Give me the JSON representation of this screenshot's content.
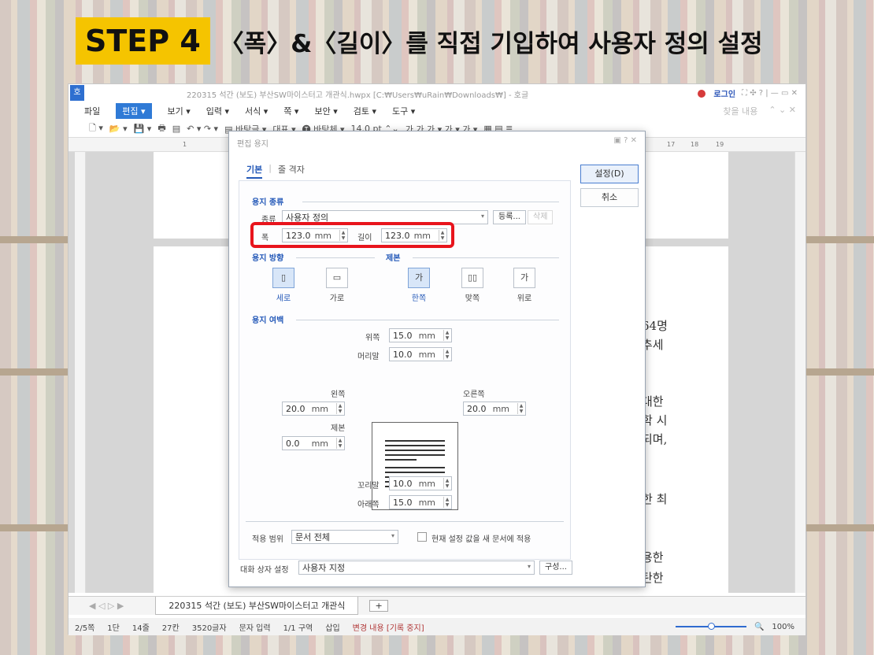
{
  "banner": {
    "step": "STEP 4",
    "title": "〈폭〉&〈길이〉를 직접 기입하여 사용자 정의 설정"
  },
  "window": {
    "title": "220315 석간 (보도) 부산SW마이스터고 개관식.hwpx [C:₩Users₩uRain₩Downloads₩] - 호글",
    "logo": "호",
    "login": "로그인",
    "controls": "⛶ ✣ ? | — ▭ ✕"
  },
  "menubar": {
    "items": [
      "파일",
      "편집 ▾",
      "보기 ▾",
      "입력 ▾",
      "서식 ▾",
      "쪽 ▾",
      "보안 ▾",
      "검토 ▾",
      "도구 ▾"
    ],
    "right": [
      "찾을 내용",
      "⌃ ⌄ ✕"
    ]
  },
  "toolbar": {
    "items": [
      "🗋 ▾",
      "📂 ▾",
      "💾 ▾",
      "🖶",
      "▤",
      "↶ ▾ ↷ ▾",
      "▤ 바탕글 ▾",
      "대표 ▾",
      "🅣 바탕체 ▾",
      "14.0 pt ⌃⌄",
      "가 가 가 ▾ 가 ▾ 가 ▾",
      "▦ ▤ ≣"
    ]
  },
  "ruler": {
    "marks": [
      "1",
      "17",
      "18",
      "19"
    ]
  },
  "document": {
    "lines": [
      "64명",
      "추세",
      "대한",
      "학 시",
      "되며,",
      "한 최",
      "용한",
      "탄한"
    ]
  },
  "tabbar": {
    "nav": "◀ ◁ ▷ ▶",
    "doc_tab": "220315 석간 (보도) 부산SW마이스터고 개관식",
    "plus": "+"
  },
  "statusbar": {
    "items": [
      "2/5쪽",
      "1단",
      "14줄",
      "27칸",
      "3520글자",
      "문자 입력",
      "1/1 구역",
      "삽입"
    ],
    "changes": "변경 내용 [기록 중지]",
    "zoom": "100%",
    "zoom_level": 0.5
  },
  "dialog": {
    "title": "편집 용지",
    "controls": "▣ ? ✕",
    "tabs": [
      "기본",
      "줄 격자"
    ],
    "ok": "설정(D)",
    "cancel": "취소",
    "paper_type": {
      "section": "용지 종류",
      "kind_label": "종류",
      "kind_value": "사용자 정의",
      "register": "등록...",
      "delete": "삭제",
      "width_label": "폭",
      "width_value": "123.0",
      "height_label": "길이",
      "height_value": "123.0",
      "unit": "mm"
    },
    "orientation": {
      "section": "용지 방향",
      "portrait": "세로",
      "landscape": "가로"
    },
    "binding": {
      "section": "제본",
      "single": "한쪽",
      "facing": "맞쪽",
      "top": "위로"
    },
    "margins": {
      "section": "용지 여백",
      "top_label": "위쪽",
      "top": "15.0",
      "header_label": "머리말",
      "header": "10.0",
      "left_label": "왼쪽",
      "left": "20.0",
      "right_label": "오른쪽",
      "right": "20.0",
      "gutter_label": "제본",
      "gutter": "0.0",
      "footer_label": "꼬리말",
      "footer": "10.0",
      "bottom_label": "아래쪽",
      "bottom": "15.0",
      "unit": "mm"
    },
    "apply": {
      "label": "적용 범위",
      "value": "문서 전체",
      "checkbox_label": "현재 설정 값을 새 문서에 적용"
    },
    "dialog_setting": {
      "label": "대화 상자 설정",
      "value": "사용자 지정",
      "button": "구성..."
    }
  },
  "colors": {
    "highlight": "#e8141c",
    "step_bg": "#f5c400",
    "accent": "#2459b8"
  }
}
